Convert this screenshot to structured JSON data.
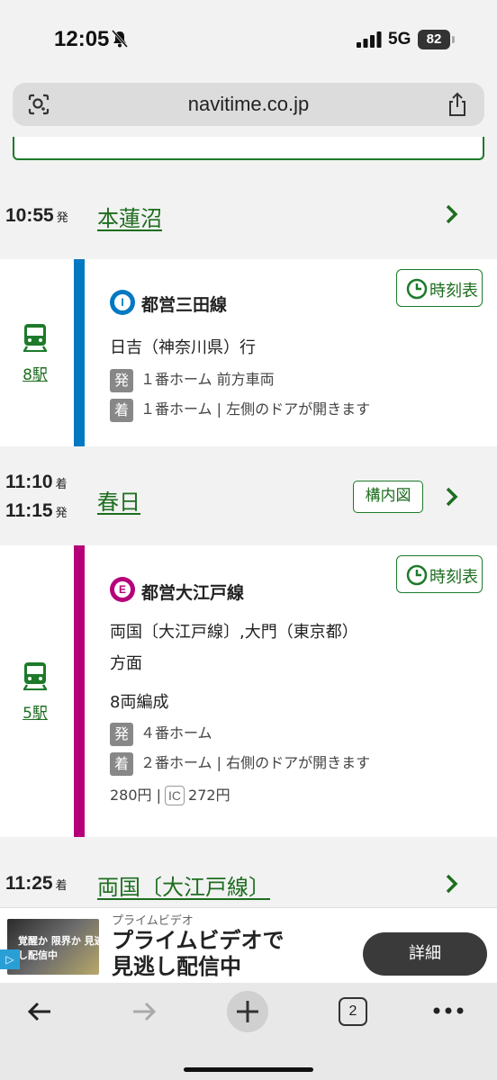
{
  "status_bar": {
    "time": "12:05",
    "network": "5G",
    "battery": "82"
  },
  "browser": {
    "url": "navitime.co.jp",
    "tab_count": "2"
  },
  "route": {
    "stations": [
      {
        "name": "本蓮沼",
        "times": [
          {
            "time": "10:55",
            "suffix": "発"
          }
        ]
      },
      {
        "name": "春日",
        "times": [
          {
            "time": "11:10",
            "suffix": "着"
          },
          {
            "time": "11:15",
            "suffix": "発"
          }
        ],
        "map_button": "構内図"
      },
      {
        "name": "両国〔大江戸線〕",
        "times": [
          {
            "time": "11:25",
            "suffix": "着"
          }
        ]
      }
    ],
    "segments": [
      {
        "line_name": "都営三田線",
        "line_letter": "I",
        "line_color": "#0079c2",
        "timetable_label": "時刻表",
        "stops": "8駅",
        "destination": "日吉（神奈川県）行",
        "departure_tag": "発",
        "departure_platform": "１番ホーム 前方車両",
        "arrival_tag": "着",
        "arrival_platform": "１番ホーム | 左側のドアが開きます"
      },
      {
        "line_name": "都営大江戸線",
        "line_letter": "E",
        "line_color": "#b6007a",
        "timetable_label": "時刻表",
        "stops": "5駅",
        "destination_line1": "両国〔大江戸線〕,大門（東京都）",
        "destination_line2": "方面",
        "cars": "8両編成",
        "departure_tag": "発",
        "departure_platform": "４番ホーム",
        "arrival_tag": "着",
        "arrival_platform": "２番ホーム | 右側のドアが開きます",
        "fare": "280円 |",
        "ic_label": "IC",
        "ic_fare": "272円"
      }
    ]
  },
  "ad": {
    "label": "プライムビデオ",
    "title_line1": "プライムビデオで",
    "title_line2": "見逃し配信中",
    "button": "詳細",
    "image_text": "覚醒か 限界か 見逃し配信中"
  },
  "colors": {
    "accent_green": "#1d6e1f",
    "mita_blue": "#0079c2",
    "oedo_magenta": "#b6007a"
  }
}
